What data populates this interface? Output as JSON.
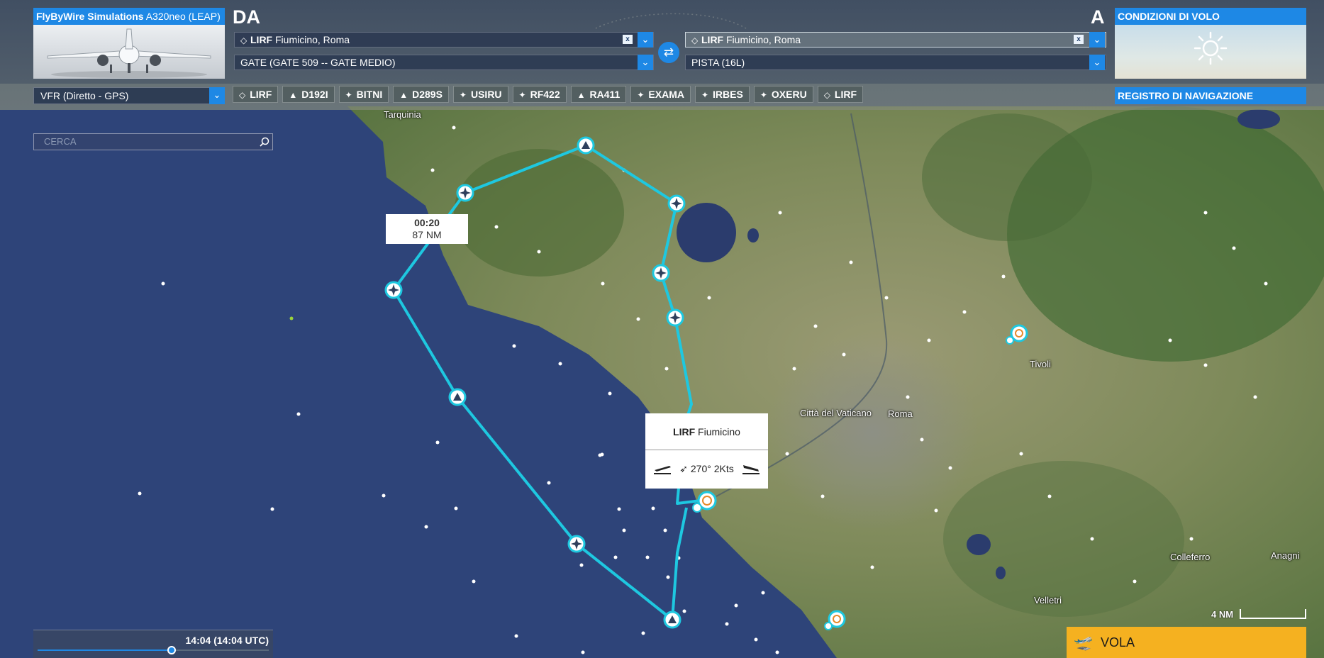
{
  "aircraft": {
    "brand": "FlyByWire Simulations",
    "model": "A320neo (LEAP)"
  },
  "departure": {
    "label": "DA",
    "airport_code": "LIRF",
    "airport_name": "Fiumicino, Roma",
    "clear_label": "x",
    "gate": "GATE (GATE 509 -- GATE MEDIO)"
  },
  "arrival": {
    "label": "A",
    "airport_code": "LIRF",
    "airport_name": "Fiumicino, Roma",
    "clear_label": "x",
    "runway": "PISTA (16L)"
  },
  "weather": {
    "title": "CONDIZIONI DI VOLO"
  },
  "flight_plan": {
    "type": "VFR (Diretto - GPS)"
  },
  "waypoints": [
    {
      "label": "LIRF",
      "icon": "airport-icon"
    },
    {
      "label": "D192I",
      "icon": "triangle-icon"
    },
    {
      "label": "BITNI",
      "icon": "star-icon"
    },
    {
      "label": "D289S",
      "icon": "triangle-icon"
    },
    {
      "label": "USIRU",
      "icon": "star-icon"
    },
    {
      "label": "RF422",
      "icon": "star-icon"
    },
    {
      "label": "RA411",
      "icon": "triangle-icon"
    },
    {
      "label": "EXAMA",
      "icon": "star-icon"
    },
    {
      "label": "IRBES",
      "icon": "star-icon"
    },
    {
      "label": "OXERU",
      "icon": "star-icon"
    },
    {
      "label": "LIRF",
      "icon": "airport-icon"
    }
  ],
  "navlog": {
    "label": "REGISTRO DI NAVIGAZIONE"
  },
  "search": {
    "placeholder": "CERCA"
  },
  "leg_info": {
    "time": "00:20",
    "distance": "87 NM"
  },
  "airport_popup": {
    "code": "LIRF",
    "name": "Fiumicino",
    "wind": "270° 2Kts"
  },
  "map_labels": {
    "tarquinia": "Tarquinia",
    "vatican": "Città del Vaticano",
    "roma": "Roma",
    "tivoli": "Tivoli",
    "colleferro": "Colleferro",
    "anagni": "Anagni",
    "velletri": "Velletri"
  },
  "time": {
    "display": "14:04 (14:04 UTC)",
    "progress": 0.58
  },
  "scale": {
    "label": "4 NM"
  },
  "fly_button": {
    "label": "VOLA"
  },
  "colors": {
    "accent": "#1e88e5",
    "route": "#1ec8e0",
    "fly": "#f5b120",
    "sea": "#2e4479"
  }
}
